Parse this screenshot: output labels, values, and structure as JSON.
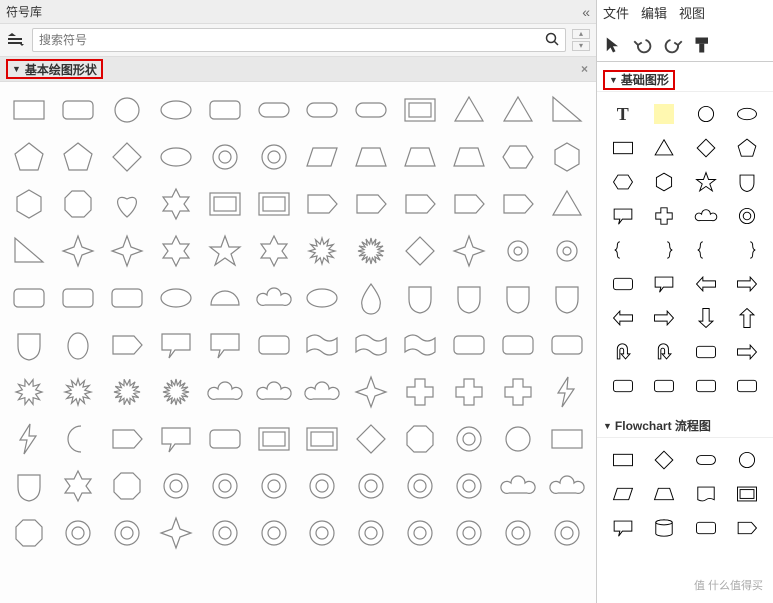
{
  "leftPanel": {
    "title": "符号库",
    "searchPlaceholder": "搜索符号",
    "category": "基本绘图形状"
  },
  "rightPanel": {
    "menu": {
      "file": "文件",
      "edit": "编辑",
      "view": "视图"
    },
    "categories": {
      "basic": "基础图形",
      "flowchart": "Flowchart 流程图"
    }
  },
  "watermark": "值 什么值得买"
}
